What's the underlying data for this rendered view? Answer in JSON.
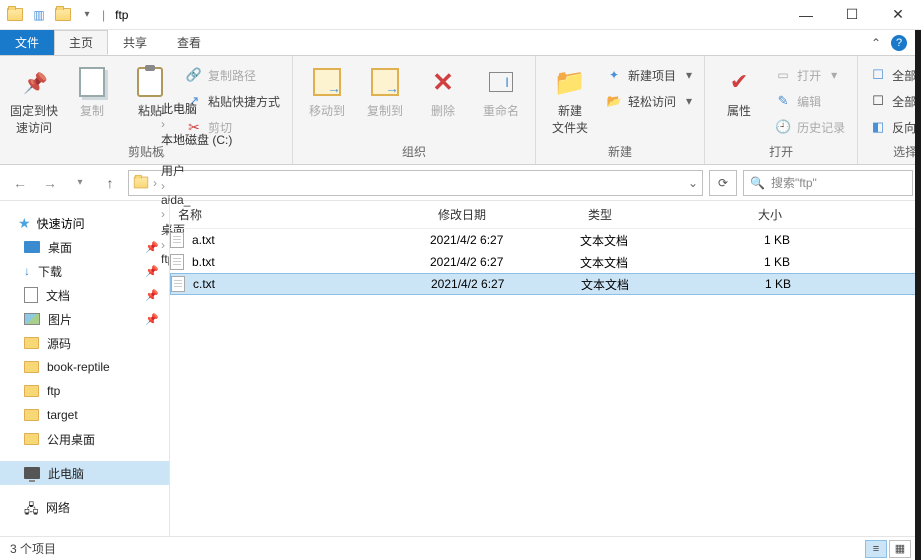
{
  "window": {
    "title": "ftp"
  },
  "tabs": {
    "file": "文件",
    "home": "主页",
    "share": "共享",
    "view": "查看"
  },
  "ribbon": {
    "clipboard": {
      "pin": "固定到快\n速访问",
      "copy": "复制",
      "paste": "粘贴",
      "copypath": "复制路径",
      "shortcut": "粘贴快捷方式",
      "cut": "剪切",
      "label": "剪贴板"
    },
    "organize": {
      "moveto": "移动到",
      "copyto": "复制到",
      "delete": "删除",
      "rename": "重命名",
      "label": "组织"
    },
    "new": {
      "folder": "新建\n文件夹",
      "newitem": "新建项目",
      "easy": "轻松访问",
      "label": "新建"
    },
    "open": {
      "props": "属性",
      "open": "打开",
      "edit": "编辑",
      "history": "历史记录",
      "label": "打开"
    },
    "select": {
      "all": "全部选择",
      "none": "全部取消",
      "invert": "反向选择",
      "label": "选择"
    }
  },
  "breadcrumb": [
    "此电脑",
    "本地磁盘 (C:)",
    "用户",
    "aida_",
    "桌面",
    "ftp"
  ],
  "search": {
    "placeholder": "搜索\"ftp\""
  },
  "sidebar": {
    "quick": "快速访问",
    "items": [
      {
        "label": "桌面",
        "pinned": true,
        "icon": "desk"
      },
      {
        "label": "下载",
        "pinned": true,
        "icon": "dl"
      },
      {
        "label": "文档",
        "pinned": true,
        "icon": "doc"
      },
      {
        "label": "图片",
        "pinned": true,
        "icon": "pic"
      },
      {
        "label": "源码",
        "pinned": false,
        "icon": "fold"
      },
      {
        "label": "book-reptile",
        "pinned": false,
        "icon": "fold"
      },
      {
        "label": "ftp",
        "pinned": false,
        "icon": "fold"
      },
      {
        "label": "target",
        "pinned": false,
        "icon": "fold"
      },
      {
        "label": "公用桌面",
        "pinned": false,
        "icon": "fold"
      }
    ],
    "pc": "此电脑",
    "net": "网络"
  },
  "columns": {
    "name": "名称",
    "date": "修改日期",
    "type": "类型",
    "size": "大小"
  },
  "files": [
    {
      "name": "a.txt",
      "date": "2021/4/2 6:27",
      "type": "文本文档",
      "size": "1 KB"
    },
    {
      "name": "b.txt",
      "date": "2021/4/2 6:27",
      "type": "文本文档",
      "size": "1 KB"
    },
    {
      "name": "c.txt",
      "date": "2021/4/2 6:27",
      "type": "文本文档",
      "size": "1 KB"
    }
  ],
  "status": {
    "count": "3 个项目"
  }
}
